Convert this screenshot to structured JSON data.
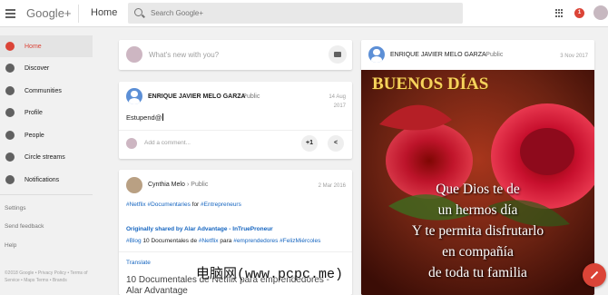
{
  "header": {
    "logo_text": "Google+",
    "page_name": "Home",
    "search_placeholder": "Search Google+",
    "notification_count": "1"
  },
  "sidebar": {
    "items": [
      {
        "label": "Home",
        "icon": "home-icon",
        "active": true
      },
      {
        "label": "Discover",
        "icon": "compass-icon"
      },
      {
        "label": "Communities",
        "icon": "communities-icon"
      },
      {
        "label": "Profile",
        "icon": "profile-icon"
      },
      {
        "label": "People",
        "icon": "people-icon"
      },
      {
        "label": "Circle streams",
        "icon": "circles-icon"
      },
      {
        "label": "Notifications",
        "icon": "bell-icon"
      }
    ],
    "links": [
      "Settings",
      "Send feedback",
      "Help"
    ],
    "footer": "©2018 Google • Privacy Policy • Terms of Service • Maps Terms • Brands"
  },
  "compose": {
    "prompt": "What's new with you?"
  },
  "posts": [
    {
      "author": "ENRIQUE JAVIER MELO GARZA",
      "visibility": "Public",
      "date_line1": "14 Aug",
      "date_line2": "2017",
      "body": "Estupend@",
      "comment_prompt": "Add a comment...",
      "plus_one": "+1"
    },
    {
      "author": "Cynthia Melo",
      "visibility": "Public",
      "date": "2 Mar 2016",
      "tag1": "#Netflix",
      "tag2": "#Documentaries",
      "for_word": "for",
      "tag3": "#Entrepreneurs",
      "shared_line": "Originally shared by Alar Advantage - InTrueProneur",
      "tag4": "#Blog",
      "plain1": "10 Documentales de",
      "tag5": "#Netflix",
      "plain2": "para",
      "tag6": "#emprendedores",
      "tag7": "#FelizMiércoles",
      "translate": "Translate",
      "headline_line1": "10 Documentales de Netflix para emprendedores -",
      "headline_line2": "Alar Advantage"
    },
    {
      "author": "ENRIQUE JAVIER MELO GARZA",
      "visibility": "Public",
      "date": "3 Nov 2017",
      "image_title": "BUENOS DÍAS",
      "image_lines": [
        "Que Dios te de",
        "un hermos día",
        "Y te permita disfrutarlo",
        "en compañía",
        "de toda tu familia"
      ]
    }
  ],
  "watermark": "电脑网(www.pcpc.me)",
  "colors": {
    "accent": "#db4437",
    "link": "#1565c0"
  }
}
